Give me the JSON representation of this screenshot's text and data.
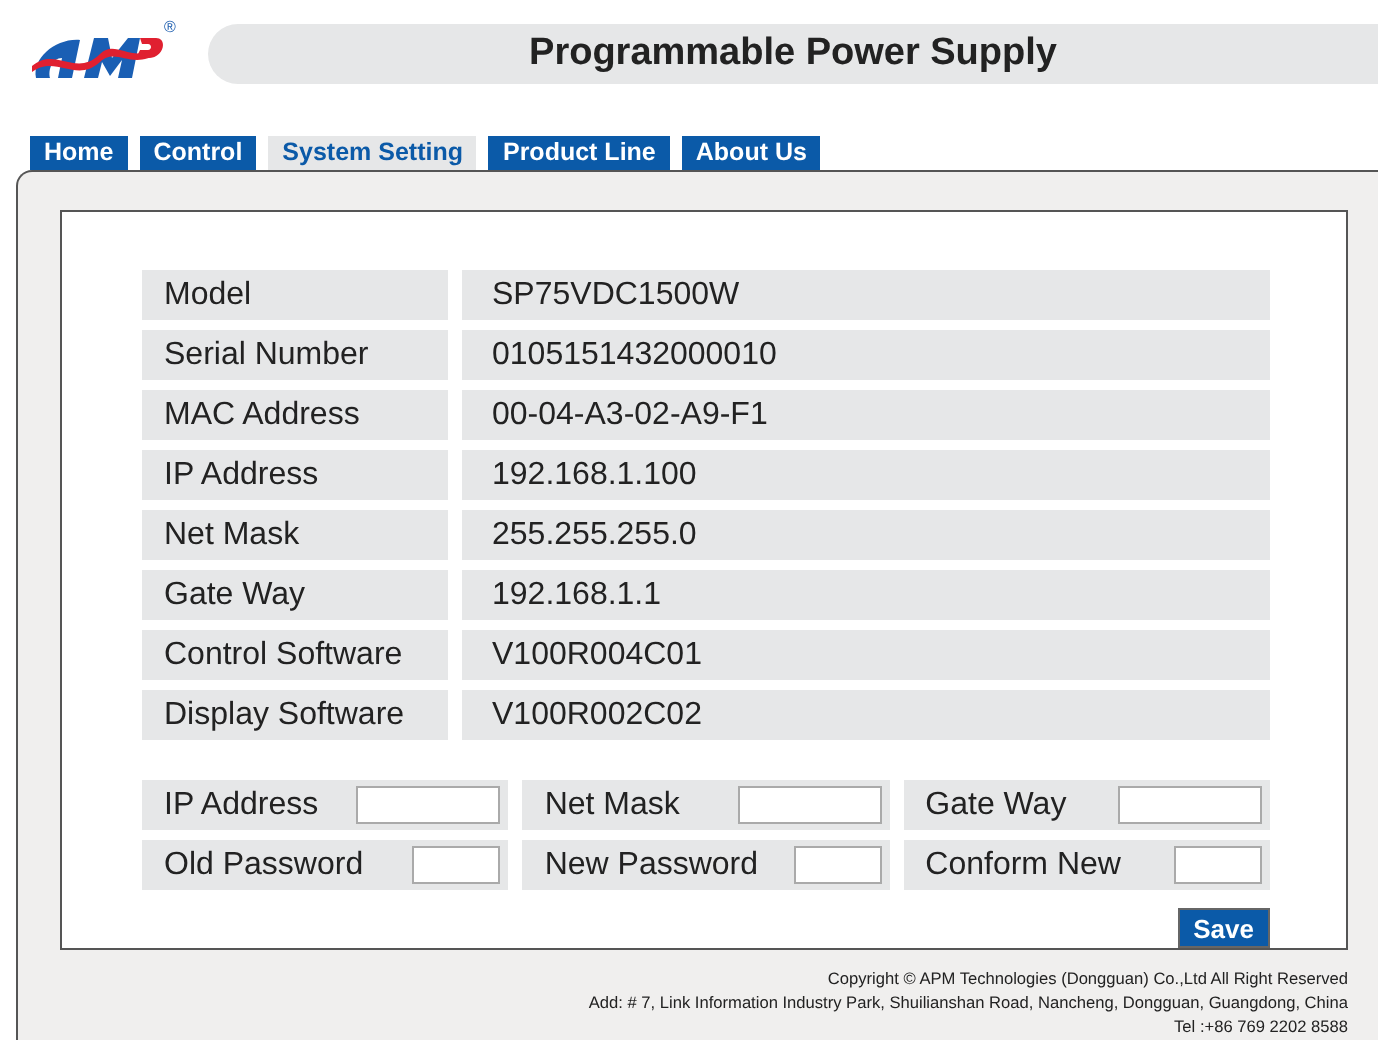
{
  "logo": {
    "mark": "®"
  },
  "header": {
    "title": "Programmable Power Supply"
  },
  "tabs": [
    {
      "label": "Home",
      "selected": false
    },
    {
      "label": "Control",
      "selected": false
    },
    {
      "label": "System Setting",
      "selected": true
    },
    {
      "label": "Product Line",
      "selected": false
    },
    {
      "label": "About Us",
      "selected": false
    }
  ],
  "info": [
    {
      "label": "Model",
      "value": "SP75VDC1500W"
    },
    {
      "label": "Serial Number",
      "value": "0105151432000010"
    },
    {
      "label": "MAC Address",
      "value": "00-04-A3-02-A9-F1"
    },
    {
      "label": "IP Address",
      "value": "192.168.1.100"
    },
    {
      "label": "Net Mask",
      "value": "255.255.255.0"
    },
    {
      "label": "Gate Way",
      "value": "192.168.1.1"
    },
    {
      "label": "Control Software",
      "value": "V100R004C01"
    },
    {
      "label": "Display Software",
      "value": "V100R002C02"
    }
  ],
  "form_rows": [
    [
      {
        "label": "IP Address",
        "kind": "wide"
      },
      {
        "label": "Net Mask",
        "kind": "wide"
      },
      {
        "label": "Gate Way",
        "kind": "wide"
      }
    ],
    [
      {
        "label": "Old Password",
        "kind": "narrow"
      },
      {
        "label": "New Password",
        "kind": "narrow"
      },
      {
        "label": "Conform New",
        "kind": "narrow"
      }
    ]
  ],
  "save_button": "Save",
  "footer": [
    "Copyright © APM Technologies (Dongguan) Co.,Ltd All Right Reserved",
    "Add: # 7, Link Information Industry Park, Shuilianshan Road, Nancheng, Dongguan, Guangdong, China",
    "Tel :+86 769 2202 8588"
  ]
}
